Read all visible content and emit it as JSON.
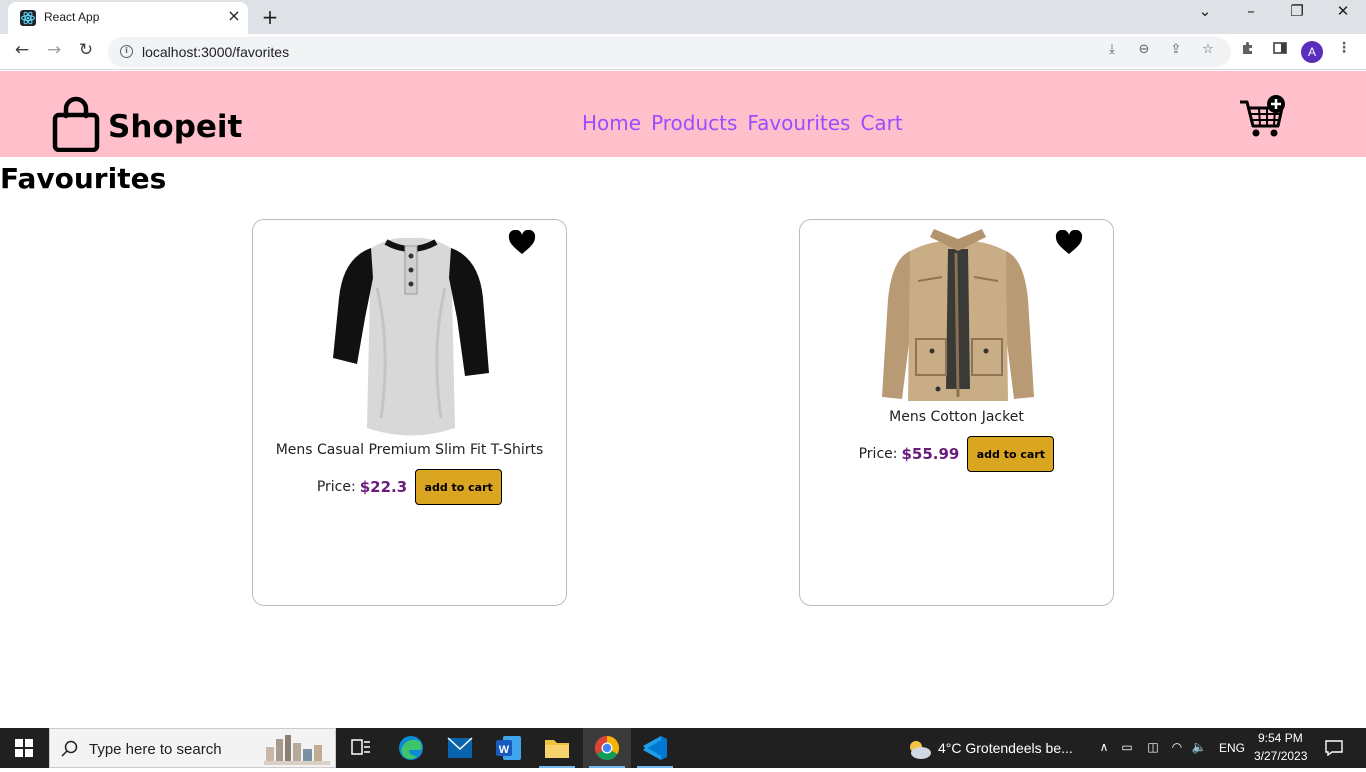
{
  "browser": {
    "tab_title": "React App",
    "tab_close": "×",
    "new_tab": "+",
    "url": "localhost:3000/favorites",
    "profile_initial": "A",
    "window_controls": {
      "dropdown": "⌄",
      "minimize": "–",
      "restore": "❐",
      "close": "✕"
    }
  },
  "site": {
    "brand": "Shopeit",
    "nav": [
      "Home",
      "Products",
      "Favourites",
      "Cart"
    ],
    "page_title": "Favourites",
    "colors": {
      "header_bg": "#ffc0cb",
      "nav_link": "#9a4dff",
      "price": "#6b1b7b",
      "button": "#daa520"
    }
  },
  "products": [
    {
      "name": "Mens Casual Premium Slim Fit T-Shirts",
      "price_label": "Price:",
      "price": "$22.3",
      "button": "add to cart",
      "favorite": true,
      "image": "raglan-henley-shirt"
    },
    {
      "name": "Mens Cotton Jacket",
      "price_label": "Price:",
      "price": "$55.99",
      "button": "add to cart",
      "favorite": true,
      "image": "khaki-cotton-jacket"
    }
  ],
  "taskbar": {
    "search_placeholder": "Type here to search",
    "weather": "4°C  Grotendeels be...",
    "language": "ENG",
    "time": "9:54 PM",
    "date": "3/27/2023"
  }
}
